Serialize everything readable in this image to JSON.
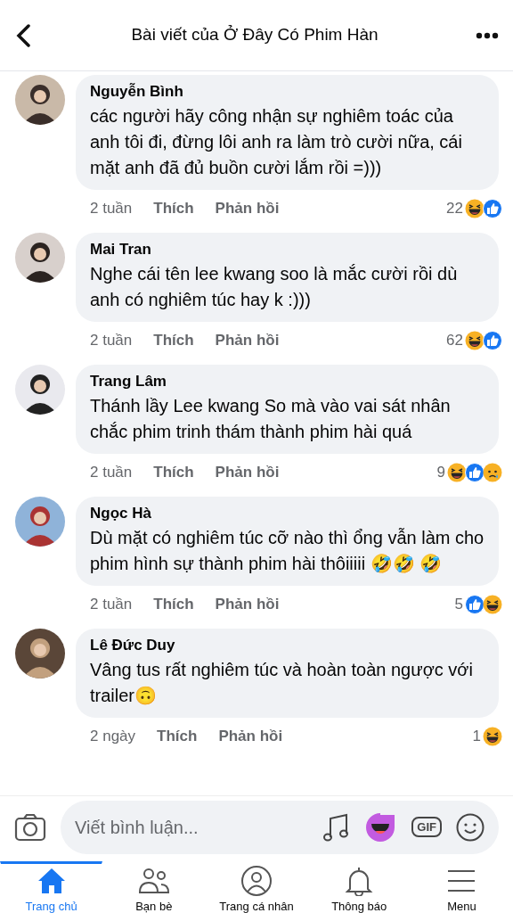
{
  "header": {
    "title": "Bài viết của Ở Đây Có Phim Hàn"
  },
  "comments": [
    {
      "name": "Nguyễn Bình",
      "text": "các người hãy công nhận sự nghiêm toác của anh tôi đi, đừng lôi anh ra làm trò cười nữa, cái mặt anh đã đủ buồn cười lắm rồi =)))",
      "time": "2 tuần",
      "like": "Thích",
      "reply": "Phản hồi",
      "count": "22",
      "reactions": [
        {
          "kind": "haha"
        },
        {
          "kind": "like"
        }
      ]
    },
    {
      "name": "Mai Tran",
      "text": "Nghe cái tên lee kwang soo là mắc cười rồi dù anh có nghiêm túc hay k :)))",
      "time": "2 tuần",
      "like": "Thích",
      "reply": "Phản hồi",
      "count": "62",
      "reactions": [
        {
          "kind": "haha"
        },
        {
          "kind": "like"
        }
      ]
    },
    {
      "name": "Trang Lâm",
      "text": "Thánh lầy Lee kwang So mà vào vai sát nhân chắc phim trinh thám thành phim hài quá",
      "time": "2 tuần",
      "like": "Thích",
      "reply": "Phản hồi",
      "count": "9",
      "reactions": [
        {
          "kind": "haha"
        },
        {
          "kind": "like"
        },
        {
          "kind": "sad"
        }
      ]
    },
    {
      "name": "Ngọc Hà",
      "text": "Dù mặt có nghiêm túc cỡ nào thì ổng vẫn làm cho phim hình sự thành phim hài thôiiiii 🤣🤣 🤣",
      "time": "2 tuần",
      "like": "Thích",
      "reply": "Phản hồi",
      "count": "5",
      "reactions": [
        {
          "kind": "like"
        },
        {
          "kind": "haha"
        }
      ]
    },
    {
      "name": "Lê Đức Duy",
      "text": "Vâng tus rất nghiêm túc và hoàn toàn ngược với trailer🙃",
      "time": "2 ngày",
      "like": "Thích",
      "reply": "Phản hồi",
      "count": "1",
      "reactions": [
        {
          "kind": "haha"
        }
      ]
    }
  ],
  "composer": {
    "placeholder": "Viết bình luận...",
    "gif": "GIF"
  },
  "nav": [
    {
      "label": "Trang chủ",
      "selected": true,
      "kind": "home"
    },
    {
      "label": "Bạn bè",
      "selected": false,
      "kind": "friends"
    },
    {
      "label": "Trang cá nhân",
      "selected": false,
      "kind": "profile"
    },
    {
      "label": "Thông báo",
      "selected": false,
      "kind": "bell"
    },
    {
      "label": "Menu",
      "selected": false,
      "kind": "menu"
    }
  ]
}
